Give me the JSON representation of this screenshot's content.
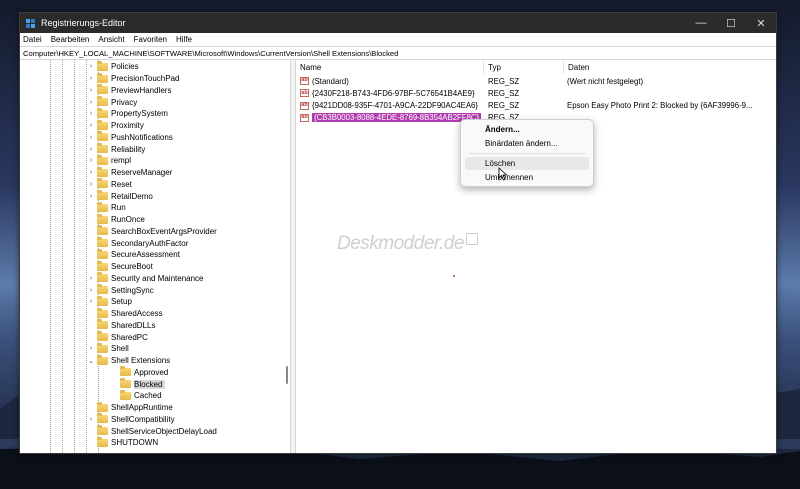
{
  "window": {
    "title": "Registrierungs-Editor"
  },
  "menu": [
    "Datei",
    "Bearbeiten",
    "Ansicht",
    "Favoriten",
    "Hilfe"
  ],
  "address": "Computer\\HKEY_LOCAL_MACHINE\\SOFTWARE\\Microsoft\\Windows\\CurrentVersion\\Shell Extensions\\Blocked",
  "tree": [
    {
      "label": "Policies",
      "expander": "›",
      "level": 0
    },
    {
      "label": "PrecisionTouchPad",
      "expander": "›",
      "level": 0
    },
    {
      "label": "PreviewHandlers",
      "expander": "›",
      "level": 0
    },
    {
      "label": "Privacy",
      "expander": "›",
      "level": 0
    },
    {
      "label": "PropertySystem",
      "expander": "›",
      "level": 0
    },
    {
      "label": "Proximity",
      "expander": "›",
      "level": 0
    },
    {
      "label": "PushNotifications",
      "expander": "›",
      "level": 0
    },
    {
      "label": "Reliability",
      "expander": "›",
      "level": 0
    },
    {
      "label": "rempl",
      "expander": "›",
      "level": 0
    },
    {
      "label": "ReserveManager",
      "expander": "›",
      "level": 0
    },
    {
      "label": "Reset",
      "expander": "›",
      "level": 0
    },
    {
      "label": "RetailDemo",
      "expander": "›",
      "level": 0
    },
    {
      "label": "Run",
      "expander": "",
      "level": 0
    },
    {
      "label": "RunOnce",
      "expander": "",
      "level": 0
    },
    {
      "label": "SearchBoxEventArgsProvider",
      "expander": "",
      "level": 0
    },
    {
      "label": "SecondaryAuthFactor",
      "expander": "",
      "level": 0
    },
    {
      "label": "SecureAssessment",
      "expander": "",
      "level": 0
    },
    {
      "label": "SecureBoot",
      "expander": "",
      "level": 0
    },
    {
      "label": "Security and Maintenance",
      "expander": "›",
      "level": 0
    },
    {
      "label": "SettingSync",
      "expander": "›",
      "level": 0
    },
    {
      "label": "Setup",
      "expander": "›",
      "level": 0
    },
    {
      "label": "SharedAccess",
      "expander": "",
      "level": 0
    },
    {
      "label": "SharedDLLs",
      "expander": "",
      "level": 0
    },
    {
      "label": "SharedPC",
      "expander": "",
      "level": 0
    },
    {
      "label": "Shell",
      "expander": "›",
      "level": 0
    },
    {
      "label": "Shell Extensions",
      "expander": "⌄",
      "level": 0
    },
    {
      "label": "Approved",
      "expander": "",
      "level": 1
    },
    {
      "label": "Blocked",
      "expander": "",
      "level": 1,
      "selected": true
    },
    {
      "label": "Cached",
      "expander": "",
      "level": 1
    },
    {
      "label": "ShellAppRuntime",
      "expander": "",
      "level": 0
    },
    {
      "label": "ShellCompatibility",
      "expander": "›",
      "level": 0
    },
    {
      "label": "ShellServiceObjectDelayLoad",
      "expander": "",
      "level": 0
    },
    {
      "label": "SHUTDOWN",
      "expander": "",
      "level": 0
    }
  ],
  "columns": {
    "name": "Name",
    "type": "Typ",
    "data": "Daten"
  },
  "values": [
    {
      "icon": "ab",
      "name": "(Standard)",
      "type": "REG_SZ",
      "data": "(Wert nicht festgelegt)"
    },
    {
      "icon": "ab",
      "name": "{2430F218-B743-4FD6-97BF-5C76541B4AE9}",
      "type": "REG_SZ",
      "data": ""
    },
    {
      "icon": "ab",
      "name": "{9421DD08-935F-4701-A9CA-22DF90AC4EA6}",
      "type": "REG_SZ",
      "data": "Epson Easy Photo Print 2: Blocked by {6AF39996-9..."
    },
    {
      "icon": "ab",
      "name": "{CB3B0003-8088-4EDE-8769-8B354AB2FF8C}",
      "type": "REG_SZ",
      "data": "",
      "selected": true
    }
  ],
  "context_menu": [
    "Ändern...",
    "Binärdaten ändern...",
    "Löschen",
    "Umbenennen"
  ],
  "watermark": "Deskmodder.de"
}
